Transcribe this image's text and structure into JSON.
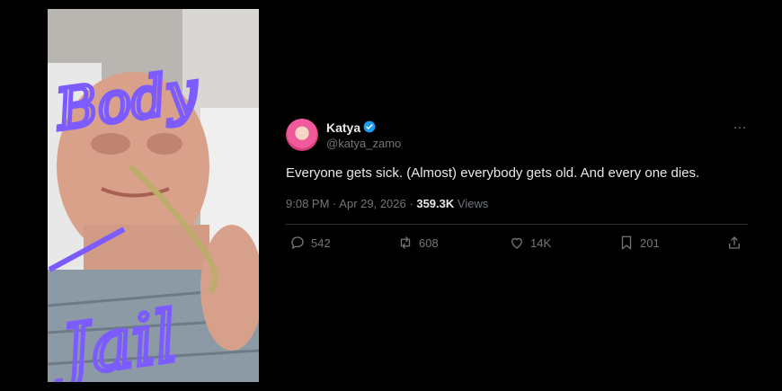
{
  "photo": {
    "overlay_text_top": "Body",
    "overlay_text_bottom": "Jail",
    "overlay_color": "#7d5cff"
  },
  "tweet": {
    "author_name": "Katya",
    "handle": "@katya_zamo",
    "verified_color": "#1d9bf0",
    "more_icon": "…",
    "text": "Everyone gets sick. (Almost) everybody gets old.  And every one dies.",
    "time": "9:08 PM",
    "separator": "·",
    "date": "Apr 29, 2026",
    "views_count": "359.3K",
    "views_label": "Views",
    "actions": {
      "replies": "542",
      "reposts": "608",
      "likes": "14K",
      "bookmarks": "201"
    }
  }
}
